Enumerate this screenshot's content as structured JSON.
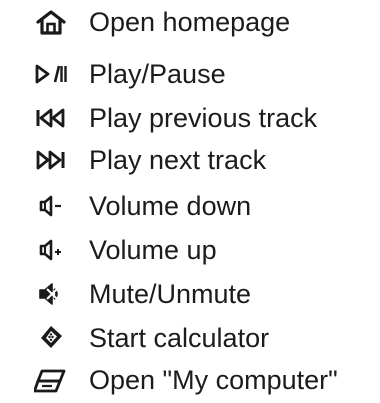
{
  "shortcuts": [
    {
      "icon": "home-icon",
      "label": "Open homepage"
    },
    {
      "icon": "play-pause-icon",
      "label": "Play/Pause"
    },
    {
      "icon": "previous-track-icon",
      "label": "Play previous track"
    },
    {
      "icon": "next-track-icon",
      "label": "Play next track"
    },
    {
      "icon": "volume-down-icon",
      "label": "Volume down"
    },
    {
      "icon": "volume-up-icon",
      "label": "Volume up"
    },
    {
      "icon": "mute-icon",
      "label": "Mute/Unmute"
    },
    {
      "icon": "calculator-icon",
      "label": "Start calculator"
    },
    {
      "icon": "my-computer-icon",
      "label": "Open \"My computer\""
    }
  ],
  "colors": {
    "text": "#1c1c1c",
    "icon": "#1a1a1a",
    "background": "#ffffff"
  }
}
